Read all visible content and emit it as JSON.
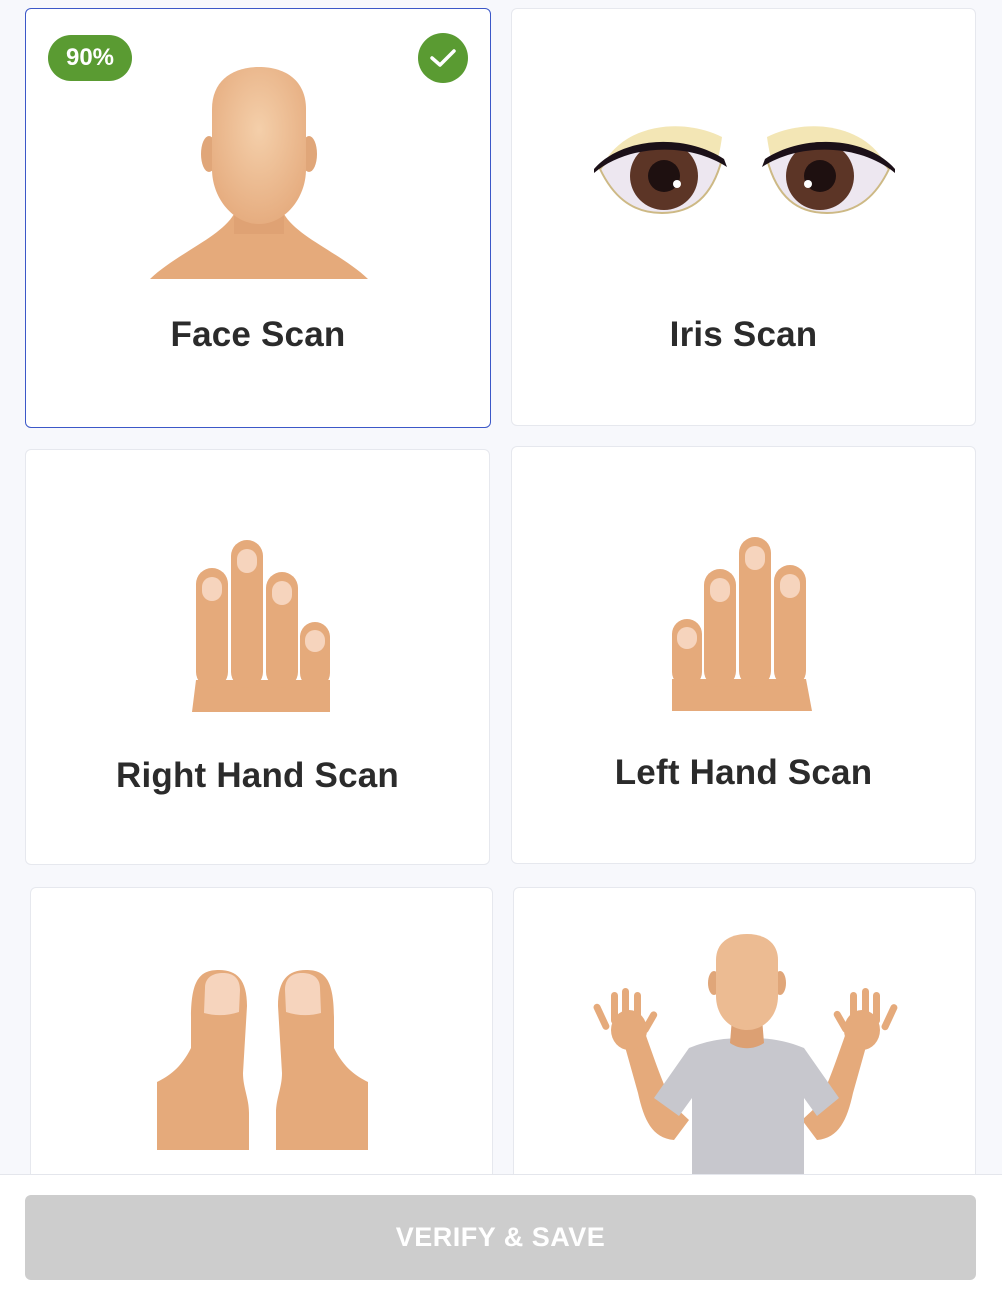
{
  "colors": {
    "accent": "#3c58c8",
    "success": "#5a9b32",
    "skin": "#e5aa7b",
    "nail": "#f6d4bd",
    "button_disabled": "#cdcdcd"
  },
  "cards": [
    {
      "label": "Face Scan",
      "selected": true,
      "quality_badge": "90%",
      "completed": true,
      "icons": [
        "face-head-icon",
        "check-icon"
      ]
    },
    {
      "label": "Iris Scan",
      "icons": [
        "eyes-icon"
      ]
    },
    {
      "label": "Right Hand Scan",
      "icons": [
        "right-hand-fingers-icon"
      ]
    },
    {
      "label": "Left Hand Scan",
      "icons": [
        "left-hand-fingers-icon"
      ]
    },
    {
      "label": "",
      "icons": [
        "thumbs-icon"
      ]
    },
    {
      "label": "",
      "icons": [
        "full-body-hands-up-icon"
      ]
    }
  ],
  "footer": {
    "verify_label": "VERIFY & SAVE",
    "verify_enabled": false
  }
}
